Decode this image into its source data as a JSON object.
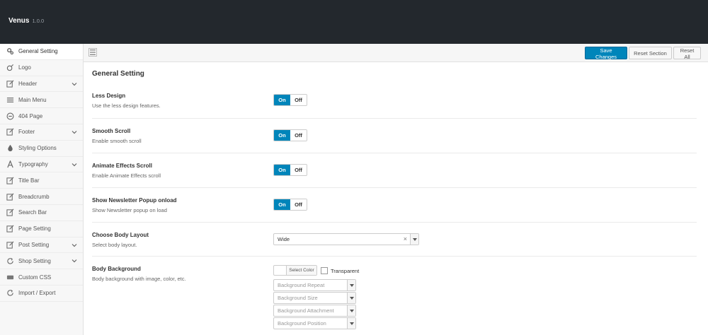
{
  "app": {
    "name": "Venus",
    "version": "1.0.0"
  },
  "sidebar": {
    "items": [
      {
        "label": "General Setting",
        "icon": "gears-icon"
      },
      {
        "label": "Logo",
        "icon": "logo-icon"
      },
      {
        "label": "Header",
        "icon": "edit-icon"
      },
      {
        "label": "Main Menu",
        "icon": "list-icon"
      },
      {
        "label": "404 Page",
        "icon": "minus-circle-icon"
      },
      {
        "label": "Footer",
        "icon": "edit-icon"
      },
      {
        "label": "Styling Options",
        "icon": "tint-icon"
      },
      {
        "label": "Typography",
        "icon": "font-icon"
      },
      {
        "label": "Title Bar",
        "icon": "edit-icon"
      },
      {
        "label": "Breadcrumb",
        "icon": "edit-icon"
      },
      {
        "label": "Search Bar",
        "icon": "edit-icon"
      },
      {
        "label": "Page Setting",
        "icon": "edit-icon"
      },
      {
        "label": "Post Setting",
        "icon": "edit-icon"
      },
      {
        "label": "Shop Setting",
        "icon": "refresh-icon"
      },
      {
        "label": "Custom CSS",
        "icon": "css-icon"
      },
      {
        "label": "Import / Export",
        "icon": "refresh-icon"
      }
    ]
  },
  "toolbar": {
    "save_label": "Save Changes",
    "reset_section_label": "Reset Section",
    "reset_all_label": "Reset All"
  },
  "main": {
    "title": "General Setting",
    "less_design": {
      "title": "Less Design",
      "desc": "Use the less design features.",
      "on": "On",
      "off": "Off"
    },
    "smooth_scroll": {
      "title": "Smooth Scroll",
      "desc": "Enable smooth scroll",
      "on": "On",
      "off": "Off"
    },
    "animate_scroll": {
      "title": "Animate Effects Scroll",
      "desc": "Enable Animate Effects scroll",
      "on": "On",
      "off": "Off"
    },
    "newsletter": {
      "title": "Show Newsletter Popup onload",
      "desc": "Show Newsletter popup on load",
      "on": "On",
      "off": "Off"
    },
    "body_layout": {
      "title": "Choose Body Layout",
      "desc": "Select body layout.",
      "value": "Wide",
      "clear": "×"
    },
    "body_background": {
      "title": "Body Background",
      "desc": "Body background with image, color, etc.",
      "select_color": "Select Color",
      "transparent_label": "Transparent",
      "repeat_placeholder": "Background Repeat",
      "size_placeholder": "Background Size",
      "attachment_placeholder": "Background Attachment",
      "position_placeholder": "Background Position"
    }
  },
  "colors": {
    "topbar": "#23282d",
    "accent": "#0085ba"
  }
}
